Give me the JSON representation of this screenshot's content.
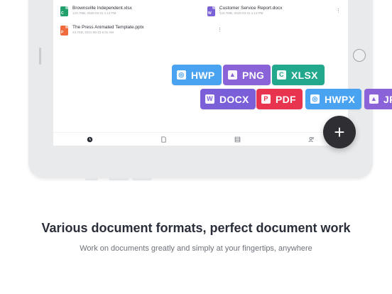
{
  "files": [
    {
      "name": "Brownsville Independent.xlsx",
      "meta": "123.7MB, 2020-03-31 1:13 PM",
      "type": "xlsx",
      "glyph": "C",
      "color": "#22a06b"
    },
    {
      "name": "Customer Service Report.docx",
      "meta": "123.7MB, 2020-03-31 1:13 PM",
      "type": "docx",
      "glyph": "W",
      "color": "#7b61d6"
    },
    {
      "name": "The Press Animated Template.pptx",
      "meta": "23.7KB, 2021-08-23 5:31 AM",
      "type": "pptx",
      "glyph": "P",
      "color": "#ef6a3c"
    }
  ],
  "bottom_nav": [
    {
      "id": "recent",
      "icon": "clock-icon"
    },
    {
      "id": "documents",
      "icon": "document-icon"
    },
    {
      "id": "templates",
      "icon": "template-icon"
    },
    {
      "id": "shared",
      "icon": "people-icon"
    }
  ],
  "formats": {
    "hwp": {
      "label": "HWP",
      "color": "#4aa3f0",
      "icon": "hwp-icon"
    },
    "png": {
      "label": "PNG",
      "color": "#8a63d8",
      "icon": "image-icon"
    },
    "xlsx": {
      "label": "XLSX",
      "color": "#22a88c",
      "icon": "cell-icon"
    },
    "docx": {
      "label": "DOCX",
      "color": "#7b5fd8",
      "icon": "word-icon"
    },
    "pdf": {
      "label": "PDF",
      "color": "#e8344e",
      "icon": "pdf-icon"
    },
    "hwpx": {
      "label": "HWPX",
      "color": "#4aa3f0",
      "icon": "hwp-icon"
    },
    "jpg": {
      "label": "JPG",
      "color": "#8a63d8",
      "icon": "image-icon"
    }
  },
  "fab": {
    "label": "+"
  },
  "headline": "Various document formats, perfect document work",
  "subline": "Work on documents greatly and simply at your fingertips, anywhere"
}
